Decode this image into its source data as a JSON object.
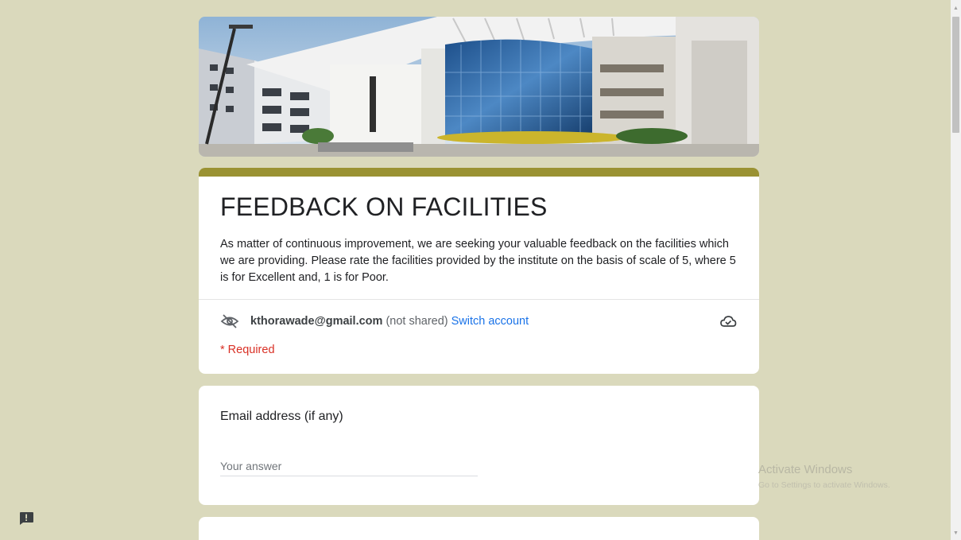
{
  "form": {
    "title": "FEEDBACK ON FACILITIES",
    "description": "As matter of continuous improvement, we are seeking your valuable feedback on the facilities which we are providing. Please rate the facilities provided by the institute on the basis of scale of 5, where 5 is for Excellent and, 1 is for Poor.",
    "accent_color": "#9a9233",
    "background_color": "#dad9bc"
  },
  "account": {
    "email": "kthorawade@gmail.com",
    "not_shared": "(not shared)",
    "switch_label": "Switch account"
  },
  "required_note": "* Required",
  "questions": [
    {
      "title": "Email address (if any)",
      "placeholder": "Your answer"
    }
  ],
  "watermark": {
    "title": "Activate Windows",
    "subtitle": "Go to Settings to activate Windows."
  },
  "icons": {
    "visibility": "eye-off-icon",
    "cloud": "cloud-done-icon",
    "report": "report-problem-icon"
  }
}
